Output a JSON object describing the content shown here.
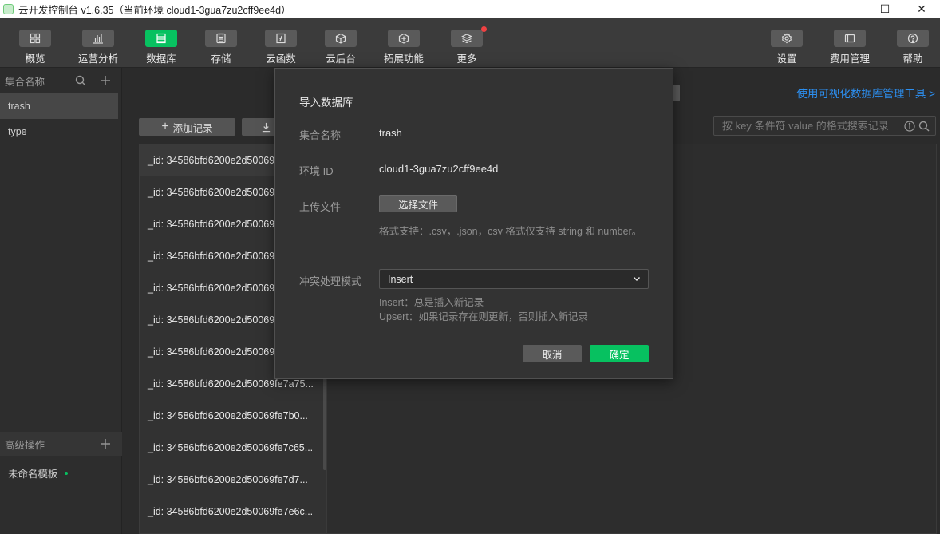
{
  "window": {
    "title": "云开发控制台 v1.6.35（当前环境 cloud1-3gua7zu2cff9ee4d）",
    "minimize": "—",
    "maximize": "☐",
    "close": "✕"
  },
  "toolbar": {
    "items": [
      {
        "label": "概览",
        "icon": "grid-icon"
      },
      {
        "label": "运营分析",
        "icon": "bar-chart-icon"
      },
      {
        "label": "数据库",
        "icon": "database-icon"
      },
      {
        "label": "存储",
        "icon": "storage-icon"
      },
      {
        "label": "云函数",
        "icon": "function-icon"
      },
      {
        "label": "云后台",
        "icon": "cube-icon"
      },
      {
        "label": "拓展功能",
        "icon": "extension-icon"
      },
      {
        "label": "更多",
        "icon": "layers-icon"
      },
      {
        "label": "设置",
        "icon": "gear-icon"
      },
      {
        "label": "费用管理",
        "icon": "billing-icon"
      },
      {
        "label": "帮助",
        "icon": "help-icon"
      }
    ],
    "active": "数据库"
  },
  "sidebar": {
    "collections_header": "集合名称",
    "collections": [
      "trash",
      "type"
    ],
    "active_collection": "trash",
    "advanced_header": "高级操作",
    "template_name": "未命名模板"
  },
  "main": {
    "viz_link": "使用可视化数据库管理工具 >",
    "add_record": "添加记录",
    "search_placeholder": "按 key 条件符 value 的格式搜索记录",
    "records": [
      "_id: 34586bfd6200e2d50069",
      "_id: 34586bfd6200e2d50069",
      "_id: 34586bfd6200e2d50069",
      "_id: 34586bfd6200e2d50069",
      "_id: 34586bfd6200e2d50069",
      "_id: 34586bfd6200e2d50069",
      "_id: 34586bfd6200e2d50069",
      "_id: 34586bfd6200e2d50069fe7a75...",
      "_id: 34586bfd6200e2d50069fe7b0...",
      "_id: 34586bfd6200e2d50069fe7c65...",
      "_id: 34586bfd6200e2d50069fe7d7...",
      "_id: 34586bfd6200e2d50069fe7e6c..."
    ]
  },
  "modal": {
    "title": "导入数据库",
    "collection_label": "集合名称",
    "collection_value": "trash",
    "env_label": "环境 ID",
    "env_value": "cloud1-3gua7zu2cff9ee4d",
    "upload_label": "上传文件",
    "choose_file": "选择文件",
    "format_hint": "格式支持：.csv，.json，csv 格式仅支持 string 和 number。",
    "conflict_label": "冲突处理模式",
    "conflict_value": "Insert",
    "insert_hint": "Insert：总是插入新记录",
    "upsert_hint": "Upsert：如果记录存在则更新，否则插入新记录",
    "cancel": "取消",
    "confirm": "确定"
  },
  "colors": {
    "accent": "#07c160",
    "link": "#2c8ff0",
    "badge": "#f04142"
  }
}
